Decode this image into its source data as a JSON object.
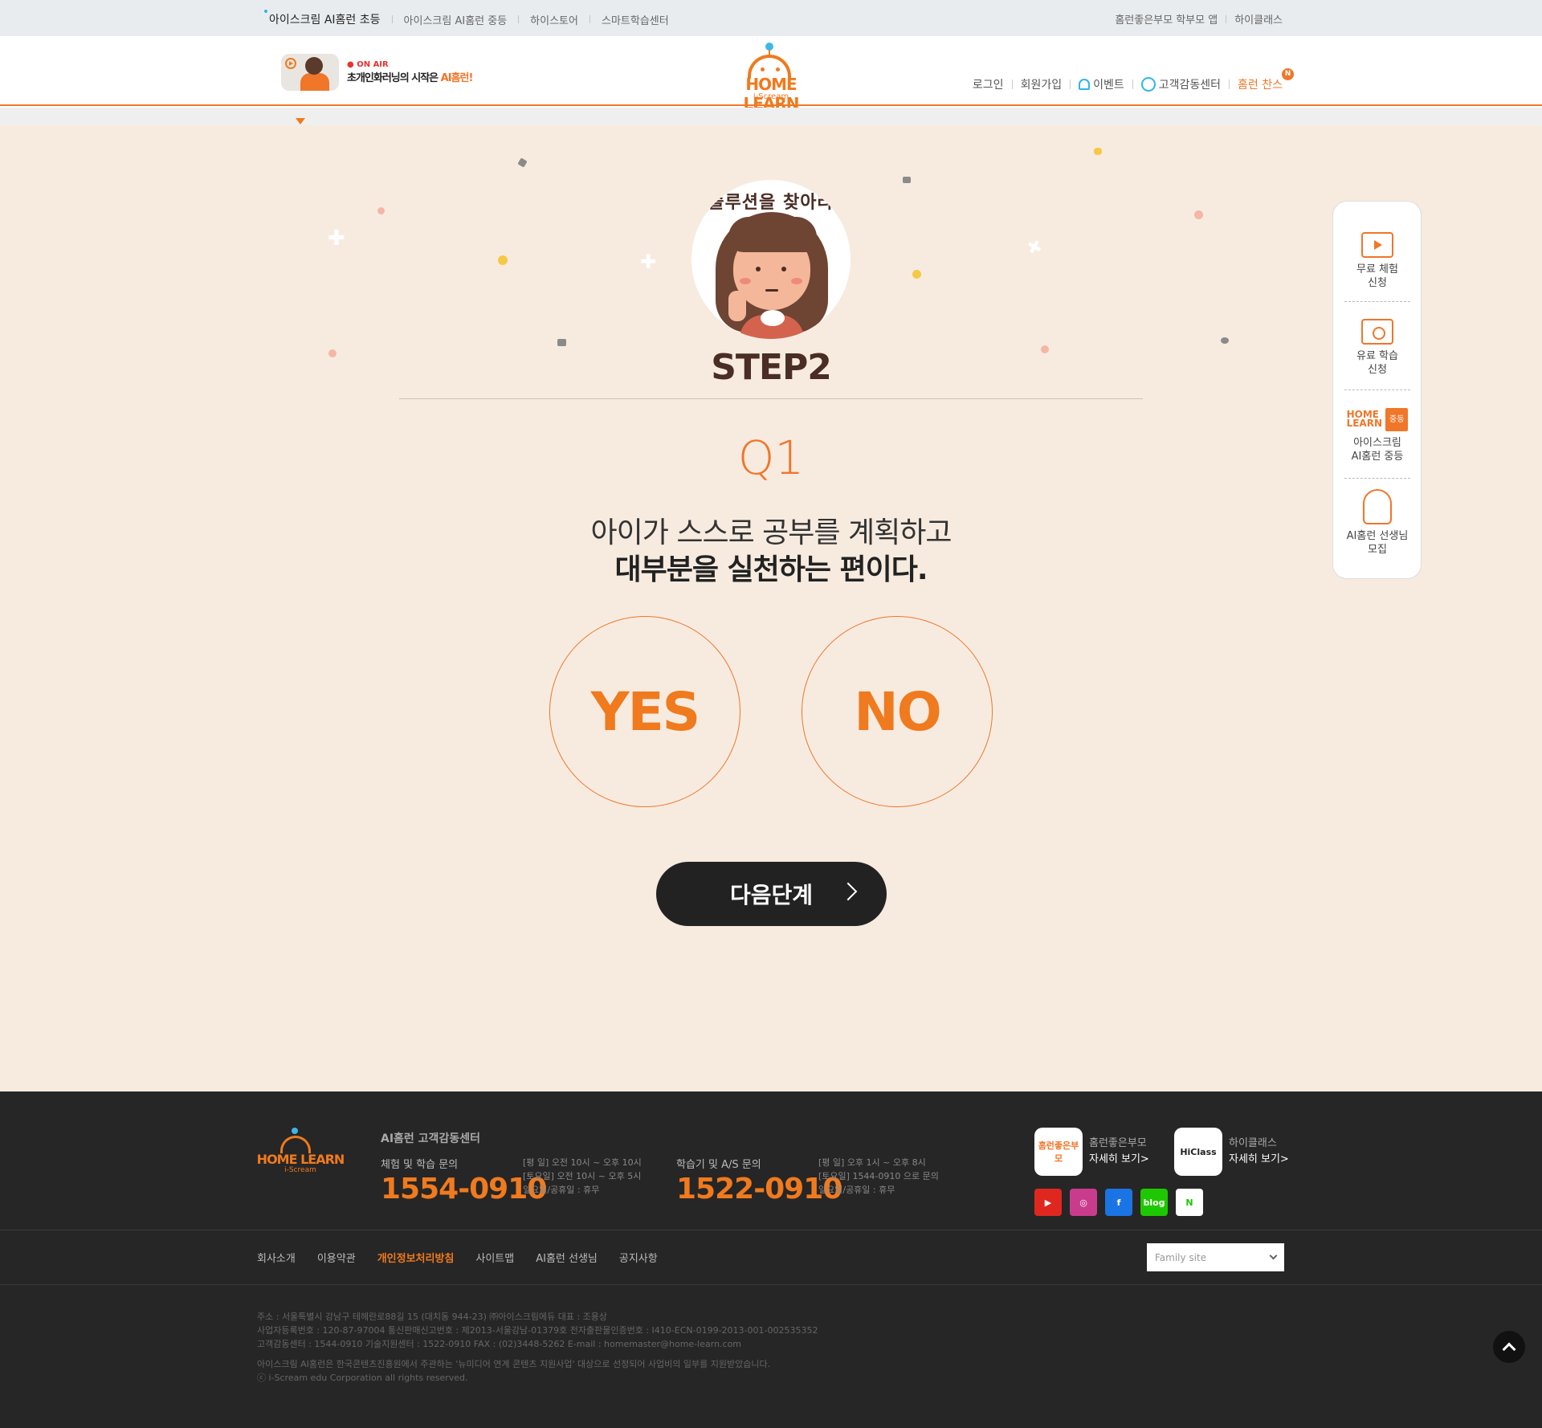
{
  "topbar": {
    "left": [
      "아이스크림 AI홈런 초등",
      "아이스크림 AI홈런 중등",
      "하이스토어",
      "스마트학습센터"
    ],
    "right": [
      "홈런좋은부모 학부모 앱",
      "하이클래스"
    ]
  },
  "header": {
    "onair_badge": "ON AIR",
    "onair_text": "초개인화러닝의 시작은 ",
    "onair_highlight": "AI홈런!",
    "logo_name": "HOME LEARN",
    "logo_sub": "i-Scream",
    "gnb": {
      "login": "로그인",
      "join": "회원가입",
      "event": "이벤트",
      "cs": "고객감동센터",
      "chance": "홈런 찬스",
      "badge": "N"
    }
  },
  "main": {
    "circle_title": "솔루션을 찾아라",
    "step": "STEP2",
    "q_number": "Q1",
    "q_line1": "아이가 스스로 공부를 계획하고",
    "q_line2": "대부분을 실천하는 편이다.",
    "yes": "YES",
    "no": "NO",
    "next": "다음단계"
  },
  "quick": {
    "free_trial_1": "무료 체험",
    "free_trial_2": "신청",
    "paid_1": "유료 학습",
    "paid_2": "신청",
    "middle_logo_top": "HOME",
    "middle_logo_bottom": "LEARN",
    "middle_badge": "중등",
    "middle_1": "아이스크림",
    "middle_2": "AI홈런 중등",
    "teacher_1": "AI홈런 선생님",
    "teacher_2": "모집"
  },
  "footer": {
    "logo_name": "HOME LEARN",
    "logo_sub": "i-Scream",
    "center_title": "AI홈런 고객감동센터",
    "cs1": {
      "label": "체험 및 학습 문의",
      "num": "1554-0910",
      "h1": "[평 일] 오전 10시 ~ 오후 10시",
      "h2": "[토요일] 오전 10시 ~ 오후 5시",
      "h3": "일요일/공휴일 : 휴무"
    },
    "cs2": {
      "label": "학습기 및 A/S 문의",
      "num": "1522-0910",
      "h1": "[평 일] 오후 1시 ~ 오후 8시",
      "h2": "[토요일] 1544-0910 으로 문의",
      "h3": "일요일/공휴일 : 휴무"
    },
    "app1": {
      "box": "홈런좋은부모",
      "name": "홈런좋은부모",
      "more": "자세히 보기>"
    },
    "app2": {
      "box": "HiClass",
      "name": "하이클래스",
      "more": "자세히 보기>"
    },
    "sns": [
      "blog",
      "N"
    ],
    "menu": [
      "회사소개",
      "이용약관",
      "개인정보처리방침",
      "사이트맵",
      "AI홈런 선생님",
      "공지사항"
    ],
    "family": "Family site",
    "info": [
      "주소 : 서울특별시 강남구 테헤란로88길 15 (대치동 944-23) ㈜아이스크림에듀     대표 : 조용상",
      "사업자등록번호 : 120-87-97004      통신판매신고번호 : 제2013-서울강남-01379호      전자출판물인증번호 : I410-ECN-0199-2013-001-002535352",
      "고객감동센터 : 1544-0910      기술지원센터 : 1522-0910      FAX : (02)3448-5262      E-mail : homemaster@home-learn.com",
      "아이스크림 AI홈런은 한국콘텐츠진흥원에서 주관하는 '뉴미디어 연계 콘텐츠 지원사업' 대상으로 선정되어 사업비의 일부를 지원받았습니다.",
      "ⓒ i-Scream edu Corporation all rights reserved."
    ]
  },
  "colors": {
    "accent": "#f0762a",
    "bg": "#f7ebe0",
    "dark": "#222222",
    "footer": "#262626"
  }
}
